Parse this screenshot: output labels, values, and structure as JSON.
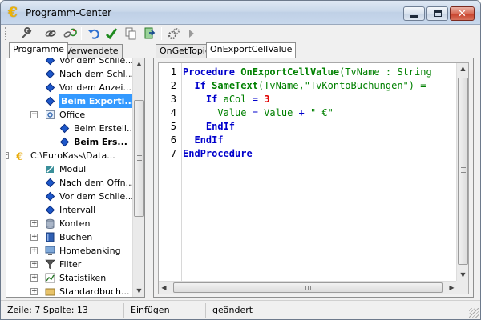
{
  "window": {
    "title": "Programm-Center",
    "app_icon_glyph": "€",
    "controls": {
      "minimize": "minimize",
      "maximize": "maximize",
      "close": "✕"
    }
  },
  "toolbar": {
    "buttons": [
      {
        "name": "wrench-icon"
      },
      {
        "name": "chain-link-icon"
      },
      {
        "name": "chain-link-refresh-icon"
      },
      {
        "name": "undo-icon"
      },
      {
        "name": "checkmark-icon"
      },
      {
        "name": "copy-icon"
      },
      {
        "name": "export-icon"
      },
      {
        "name": "gears-icon"
      },
      {
        "name": "play-icon"
      }
    ]
  },
  "left_panel": {
    "tabs": [
      "Programme",
      "Verwendete"
    ],
    "active_tab": 0,
    "tree": [
      {
        "label": "Vor dem Schlie...",
        "icon": "diamond-icon",
        "indent": 3
      },
      {
        "label": "Nach dem Schl...",
        "icon": "diamond-icon",
        "indent": 3
      },
      {
        "label": "Vor dem Anzei...",
        "icon": "diamond-icon",
        "indent": 3
      },
      {
        "label": "Beim Exporti...",
        "icon": "diamond-icon",
        "indent": 3,
        "selected": true
      },
      {
        "label": "Office",
        "icon": "gear-document-icon",
        "indent": 3,
        "expander": "⊟"
      },
      {
        "label": "Beim Erstell...",
        "icon": "diamond-icon",
        "indent": 4
      },
      {
        "label": "Beim Ers...",
        "icon": "diamond-icon",
        "indent": 4,
        "bold": true
      },
      {
        "label": "C:\\EuroKass\\Data...",
        "icon": "euro-icon",
        "indent": 1,
        "expander": "⊟"
      },
      {
        "label": "Modul",
        "icon": "module-icon",
        "indent": 3
      },
      {
        "label": "Nach dem Öffn...",
        "icon": "diamond-icon",
        "indent": 3
      },
      {
        "label": "Vor dem Schlie...",
        "icon": "diamond-icon",
        "indent": 3
      },
      {
        "label": "Intervall",
        "icon": "diamond-icon",
        "indent": 3
      },
      {
        "label": "Konten",
        "icon": "database-icon",
        "indent": 3,
        "expander": "⊞"
      },
      {
        "label": "Buchen",
        "icon": "book-icon",
        "indent": 3,
        "expander": "⊞"
      },
      {
        "label": "Homebanking",
        "icon": "computer-icon",
        "indent": 3,
        "expander": "⊞"
      },
      {
        "label": "Filter",
        "icon": "funnel-icon",
        "indent": 3,
        "expander": "⊞"
      },
      {
        "label": "Statistiken",
        "icon": "chart-icon",
        "indent": 3,
        "expander": "⊞"
      },
      {
        "label": "Standardbuch...",
        "icon": "folder-icon",
        "indent": 3,
        "expander": "⊞"
      }
    ]
  },
  "right_panel": {
    "tabs": [
      "OnGetTopic",
      "OnExportCellValue"
    ],
    "active_tab": 1,
    "code_lines": [
      {
        "n": "1",
        "tokens": [
          [
            "kw",
            "Procedure "
          ],
          [
            "fn",
            "OnExportCellValue"
          ],
          [
            "st",
            "(TvName : String"
          ]
        ]
      },
      {
        "n": "2",
        "tokens": [
          [
            "op",
            "  "
          ],
          [
            "kw",
            "If "
          ],
          [
            "fn",
            "SameText"
          ],
          [
            "st",
            "(TvName,\"TvKontoBuchungen\") ="
          ]
        ]
      },
      {
        "n": "3",
        "tokens": [
          [
            "op",
            "    "
          ],
          [
            "kw",
            "If "
          ],
          [
            "vr",
            "aCol"
          ],
          [
            "op",
            " = "
          ],
          [
            "nm",
            "3"
          ]
        ]
      },
      {
        "n": "4",
        "tokens": [
          [
            "op",
            "      "
          ],
          [
            "vr",
            "Value"
          ],
          [
            "op",
            " = "
          ],
          [
            "vr",
            "Value"
          ],
          [
            "op",
            " + "
          ],
          [
            "st",
            "\" €\""
          ]
        ]
      },
      {
        "n": "5",
        "tokens": [
          [
            "op",
            "    "
          ],
          [
            "kw",
            "EndIf"
          ]
        ]
      },
      {
        "n": "6",
        "tokens": [
          [
            "op",
            "  "
          ],
          [
            "kw",
            "EndIf"
          ]
        ]
      },
      {
        "n": "7",
        "tokens": [
          [
            "kw",
            "EndProcedure"
          ]
        ]
      }
    ]
  },
  "statusbar": {
    "position": "Zeile: 7 Spalte: 13",
    "mode": "Einfügen",
    "state": "geändert"
  },
  "colors": {
    "selection": "#3399ff",
    "keyword": "#0000cc",
    "identifier": "#008000",
    "number": "#e00000",
    "tree_diamond": "#1d57c9"
  }
}
